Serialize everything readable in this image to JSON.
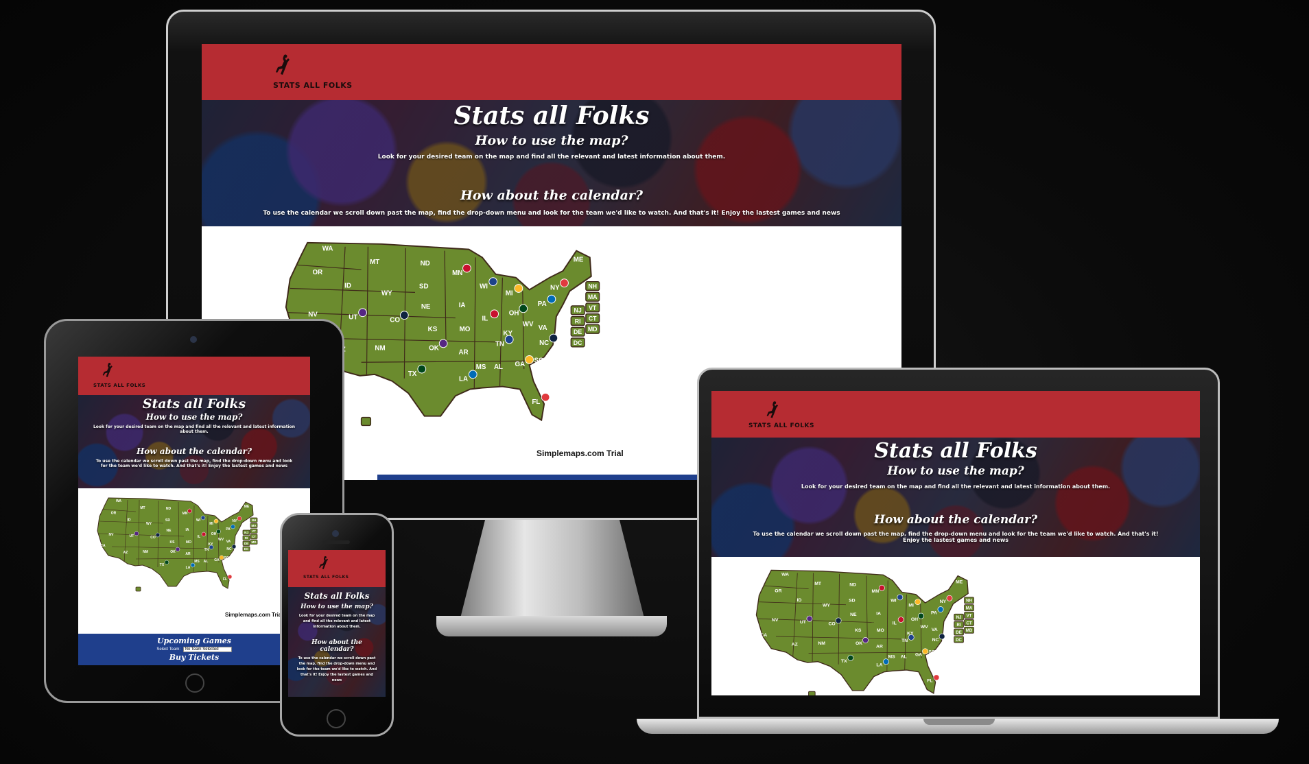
{
  "site": {
    "logo_text": "STATS ALL FOLKS",
    "title": "Stats all Folks",
    "map_heading": "How to use the map?",
    "map_text": "Look for your desired team on the map and find all the relevant and latest information about them.",
    "calendar_heading": "How about the calendar?",
    "calendar_text": "To use the calendar we scroll down past the map, find the drop-down menu and look for the team we'd like to watch. And that's it! Enjoy the lastest games and news",
    "map_credit": "Simplemaps.com Trial",
    "upcoming_games": "Upcoming Games",
    "select_team_label": "Select Team:",
    "select_team_value": "No Team Selected",
    "buy_tickets": "Buy Tickets"
  },
  "map": {
    "states": [
      {
        "abbr": "WA"
      },
      {
        "abbr": "OR"
      },
      {
        "abbr": "MT"
      },
      {
        "abbr": "ND"
      },
      {
        "abbr": "ID"
      },
      {
        "abbr": "WY"
      },
      {
        "abbr": "SD"
      },
      {
        "abbr": "MN"
      },
      {
        "abbr": "WI"
      },
      {
        "abbr": "MI"
      },
      {
        "abbr": "NY"
      },
      {
        "abbr": "ME"
      },
      {
        "abbr": "NV"
      },
      {
        "abbr": "UT"
      },
      {
        "abbr": "CO"
      },
      {
        "abbr": "NE"
      },
      {
        "abbr": "IA"
      },
      {
        "abbr": "IL"
      },
      {
        "abbr": "OH"
      },
      {
        "abbr": "PA"
      },
      {
        "abbr": "CA"
      },
      {
        "abbr": "AZ"
      },
      {
        "abbr": "NM"
      },
      {
        "abbr": "KS"
      },
      {
        "abbr": "MO"
      },
      {
        "abbr": "KY"
      },
      {
        "abbr": "WV"
      },
      {
        "abbr": "VA"
      },
      {
        "abbr": "OK"
      },
      {
        "abbr": "AR"
      },
      {
        "abbr": "TN"
      },
      {
        "abbr": "NC"
      },
      {
        "abbr": "SC"
      },
      {
        "abbr": "TX"
      },
      {
        "abbr": "LA"
      },
      {
        "abbr": "MS"
      },
      {
        "abbr": "AL"
      },
      {
        "abbr": "GA"
      },
      {
        "abbr": "FL"
      }
    ],
    "side_boxes": [
      "NH",
      "MA",
      "VT",
      "CT",
      "NJ",
      "RI",
      "DE",
      "MD",
      "DC"
    ],
    "colors": {
      "land": "#6b8b2e",
      "border": "#3f2a1a",
      "label": "#ffffff",
      "box_fill": "#6b8b2e"
    }
  },
  "colors": {
    "header": "#b62c32",
    "games_bar": "#1f3f8c"
  }
}
